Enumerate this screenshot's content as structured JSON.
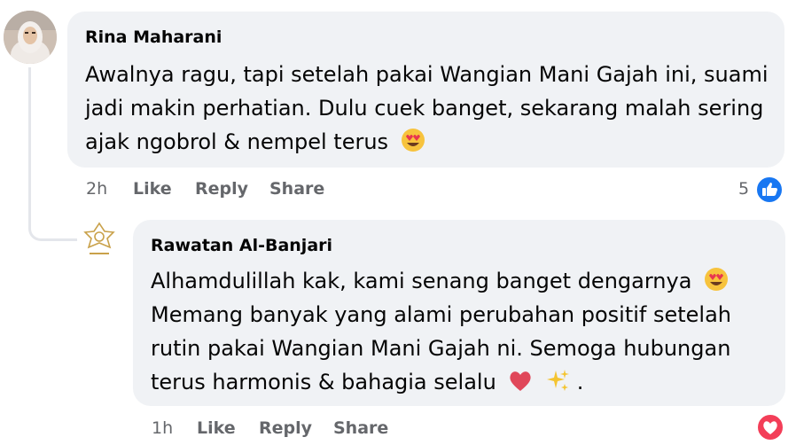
{
  "comment": {
    "author": "Rina Maharani",
    "lines": [
      "Awalnya ragu, tapi setelah pakai Wangian Mani Gajah ini, suami",
      "jadi makin perhatian. Dulu cuek banget, sekarang malah sering",
      "ajak ngobrol & nempel terus"
    ],
    "time": "2h",
    "like_label": "Like",
    "reply_label": "Reply",
    "share_label": "Share",
    "reaction_count": "5",
    "reaction_icon": "like-thumb-icon"
  },
  "reply": {
    "author": "Rawatan Al-Banjari",
    "lines": [
      "Alhamdulillah kak, kami senang banget dengarnya",
      "Memang banyak yang alami perubahan positif setelah",
      "rutin pakai Wangian Mani Gajah ni. Semoga hubungan",
      "terus harmonis & bahagia selalu",
      "."
    ],
    "time": "1h",
    "like_label": "Like",
    "reply_label": "Reply",
    "share_label": "Share",
    "reaction_icon": "love-heart-icon"
  },
  "colors": {
    "bubble": "#f0f2f5",
    "meta_text": "#65676b",
    "like_blue": "#1877f2",
    "love_red": "#f33e58",
    "thread_line": "#e4e6eb"
  }
}
